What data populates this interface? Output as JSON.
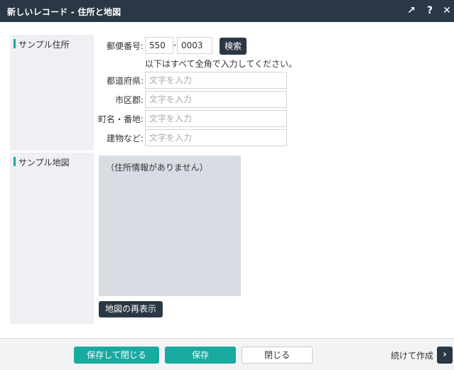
{
  "window": {
    "title": "新しいレコード - 住所と地図",
    "expand_icon": "↗",
    "help_icon": "?",
    "close_icon": "✕"
  },
  "address_section": {
    "label": "サンプル住所",
    "postal_label": "郵便番号:",
    "postal_first": "550",
    "postal_dash": "-",
    "postal_second": "0003",
    "search_button": "検索",
    "hint": "以下はすべて全角で入力してください。",
    "fields": [
      {
        "label": "都道府県:",
        "placeholder": "文字を入力"
      },
      {
        "label": "市区郡:",
        "placeholder": "文字を入力"
      },
      {
        "label": "町名・番地:",
        "placeholder": "文字を入力"
      },
      {
        "label": "建物など:",
        "placeholder": "文字を入力"
      }
    ]
  },
  "map_section": {
    "label": "サンプル地図",
    "no_info_message": "（住所情報がありません）",
    "redisplay_button": "地図の再表示"
  },
  "footer": {
    "save_close_button": "保存して閉じる",
    "save_button": "保存",
    "close_button": "閉じる",
    "continue_label": "続けて作成",
    "continue_icon": "›"
  },
  "colors": {
    "titlebar": "#2a3744",
    "accent_teal": "#18aaa0",
    "section_bg": "#eef0f3",
    "map_bg": "#d8dce3"
  }
}
